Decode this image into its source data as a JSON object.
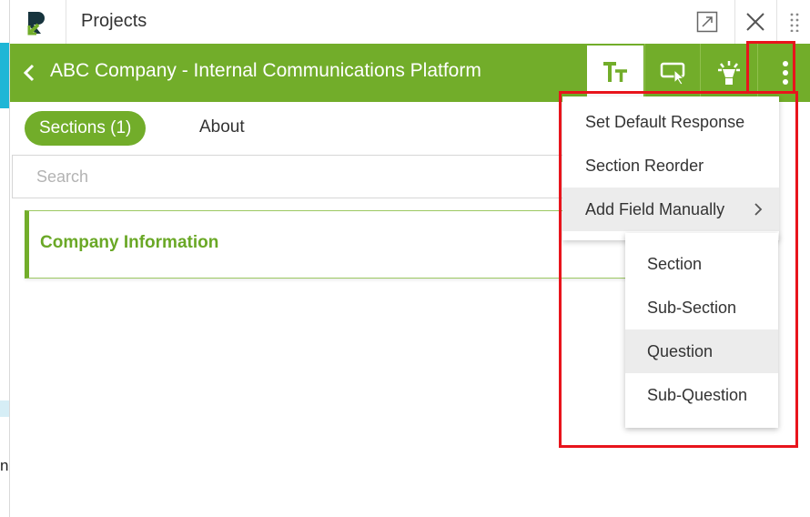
{
  "background": {
    "edge_letter": "n"
  },
  "window": {
    "title": "Projects",
    "logo_letter": "R"
  },
  "header": {
    "project_title": "ABC Company - Internal Communications Platform",
    "text_tool_label": "TT"
  },
  "tabs": {
    "sections_label": "Sections (1)",
    "about_label": "About"
  },
  "search": {
    "placeholder": "Search",
    "value": ""
  },
  "sections": [
    {
      "label": "Company Information"
    }
  ],
  "menu": {
    "items": [
      {
        "label": "Set Default Response"
      },
      {
        "label": "Section Reorder"
      },
      {
        "label": "Add Field Manually"
      }
    ],
    "submenu": [
      {
        "label": "Section"
      },
      {
        "label": "Sub-Section"
      },
      {
        "label": "Question"
      },
      {
        "label": "Sub-Question"
      }
    ]
  },
  "colors": {
    "brand_green": "#72ad2a",
    "highlight_red": "#e8141c",
    "logo_dark": "#17343d"
  },
  "icons": [
    "logo-icon",
    "expand-icon",
    "close-icon",
    "drag-handle-icon",
    "back-chevron-icon",
    "text-format-icon",
    "screen-pointer-icon",
    "lightbulb-icon",
    "more-vertical-icon",
    "chevron-right-icon"
  ]
}
